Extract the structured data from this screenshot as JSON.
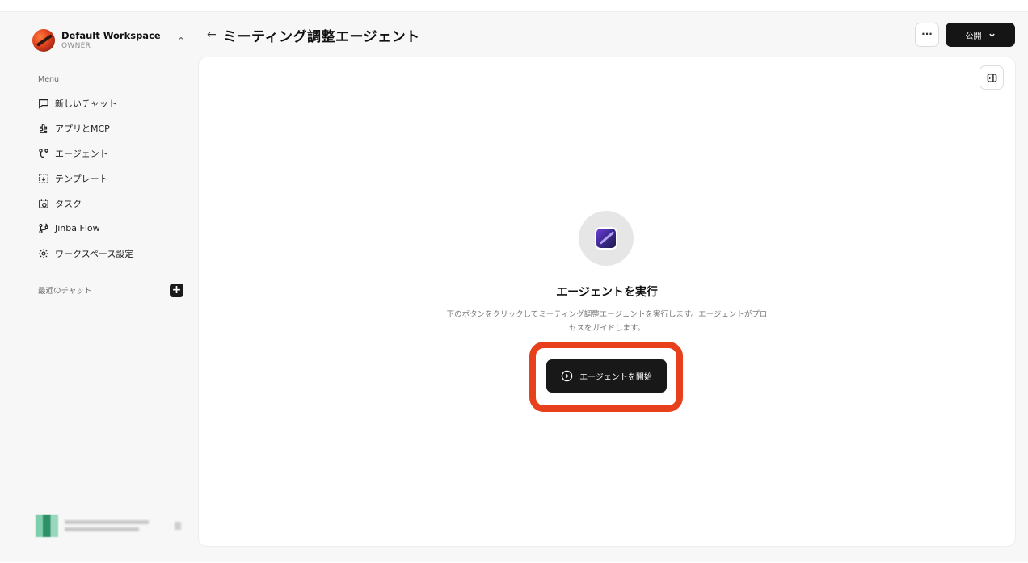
{
  "workspace": {
    "name": "Default Workspace",
    "role": "OWNER"
  },
  "sidebar": {
    "menu_label": "Menu",
    "items": [
      {
        "label": "新しいチャット",
        "icon": "chat-icon"
      },
      {
        "label": "アプリとMCP",
        "icon": "puzzle-icon"
      },
      {
        "label": "エージェント",
        "icon": "agent-icon"
      },
      {
        "label": "テンプレート",
        "icon": "template-icon"
      },
      {
        "label": "タスク",
        "icon": "calendar-clock-icon"
      },
      {
        "label": "Jinba Flow",
        "icon": "flow-icon"
      },
      {
        "label": "ワークスペース設定",
        "icon": "gear-icon"
      }
    ],
    "recent_label": "最近のチャット"
  },
  "header": {
    "title": "ミーティング調整エージェント",
    "more_label": "···",
    "publish_label": "公開"
  },
  "main": {
    "run_title": "エージェントを実行",
    "run_description": "下のボタンをクリックしてミーティング調整エージェントを実行します。エージェントがプロセスをガイドします。",
    "start_button_label": "エージェントを開始"
  },
  "colors": {
    "accent_dark": "#181818",
    "highlight": "#e8401c",
    "background": "#f7f7f7"
  }
}
